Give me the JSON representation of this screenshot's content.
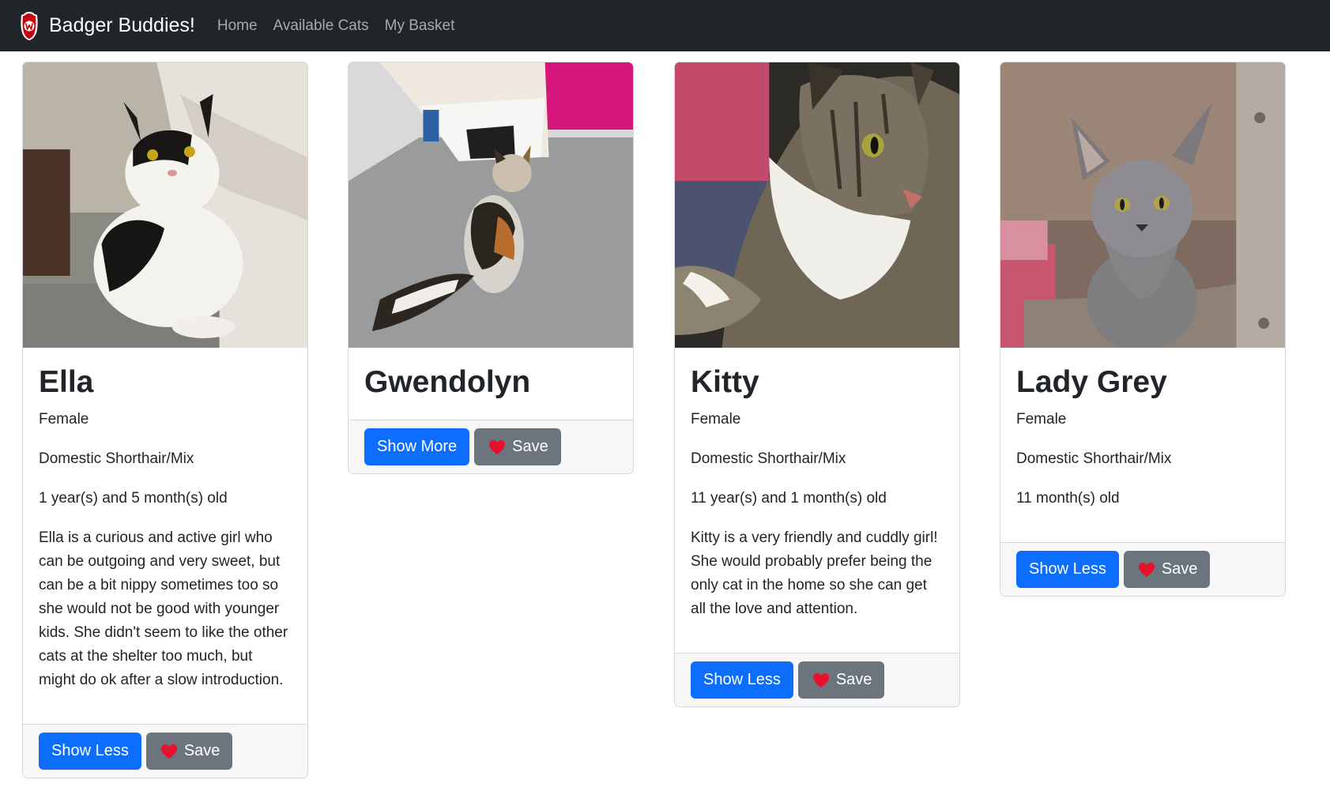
{
  "navbar": {
    "brand": "Badger Buddies!",
    "links": [
      "Home",
      "Available Cats",
      "My Basket"
    ]
  },
  "cats": [
    {
      "name": "Ella",
      "gender": "Female",
      "breed": "Domestic Shorthair/Mix",
      "age": "1 year(s) and 5 month(s) old",
      "description": "Ella is a curious and active girl who can be outgoing and very sweet, but can be a bit nippy sometimes too so she would not be good with younger kids. She didn't seem to like the other cats at the shelter too much, but might do ok after a slow introduction.",
      "toggle_label": "Show Less",
      "save_label": "Save"
    },
    {
      "name": "Gwendolyn",
      "toggle_label": "Show More",
      "save_label": "Save"
    },
    {
      "name": "Kitty",
      "gender": "Female",
      "breed": "Domestic Shorthair/Mix",
      "age": "11 year(s) and 1 month(s) old",
      "description": "Kitty is a very friendly and cuddly girl! She would probably prefer being the only cat in the home so she can get all the love and attention.",
      "toggle_label": "Show Less",
      "save_label": "Save"
    },
    {
      "name": "Lady Grey",
      "gender": "Female",
      "breed": "Domestic Shorthair/Mix",
      "age": "11 month(s) old",
      "toggle_label": "Show Less",
      "save_label": "Save"
    }
  ],
  "colors": {
    "navbar_bg": "#212529",
    "primary": "#0d6efd",
    "secondary": "#6c757d",
    "heart": "#e8112d"
  },
  "icons": {
    "brand": "uw-crest-icon",
    "save": "heart-icon"
  }
}
